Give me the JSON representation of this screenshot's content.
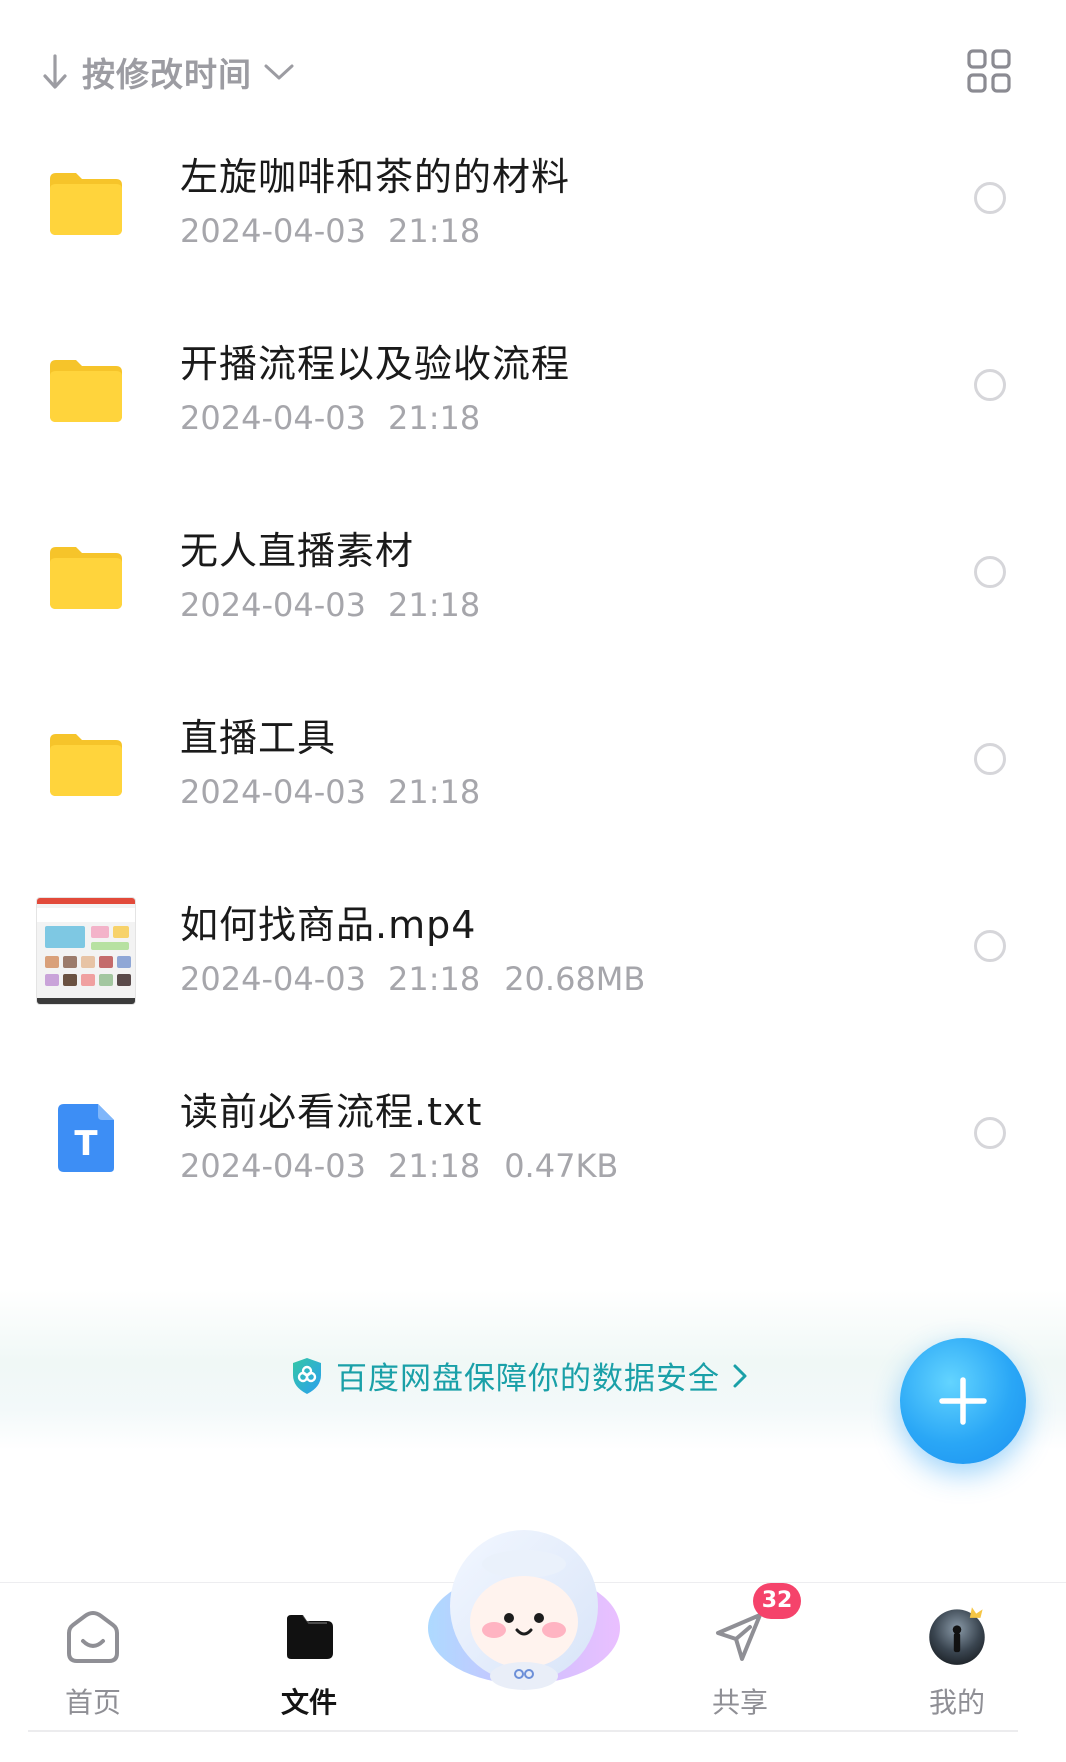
{
  "toolbar": {
    "sort_label": "按修改时间",
    "sort_icon": "arrow-down-icon",
    "view_toggle_icon": "grid-view-icon"
  },
  "files": [
    {
      "name": "左旋咖啡和茶的的材料",
      "date": "2024-04-03",
      "time": "21:18",
      "size": "",
      "type": "folder"
    },
    {
      "name": "开播流程以及验收流程",
      "date": "2024-04-03",
      "time": "21:18",
      "size": "",
      "type": "folder"
    },
    {
      "name": "无人直播素材",
      "date": "2024-04-03",
      "time": "21:18",
      "size": "",
      "type": "folder"
    },
    {
      "name": "直播工具",
      "date": "2024-04-03",
      "time": "21:18",
      "size": "",
      "type": "folder"
    },
    {
      "name": "如何找商品.mp4",
      "date": "2024-04-03",
      "time": "21:18",
      "size": "20.68MB",
      "type": "video"
    },
    {
      "name": "读前必看流程.txt",
      "date": "2024-04-03",
      "time": "21:18",
      "size": "0.47KB",
      "type": "text"
    }
  ],
  "txt_icon_letter": "T",
  "security_banner": {
    "text": "百度网盘保障你的数据安全"
  },
  "fab": {
    "icon": "plus-icon"
  },
  "tabbar": {
    "home": {
      "label": "首页"
    },
    "files": {
      "label": "文件"
    },
    "share": {
      "label": "共享",
      "badge": "32"
    },
    "mine": {
      "label": "我的"
    }
  },
  "colors": {
    "folder": "#ffd43c",
    "accent": "#2aa7f6",
    "security_text": "#1aa0a8",
    "badge": "#f5436b",
    "txt_icon": "#3d8ef5"
  }
}
